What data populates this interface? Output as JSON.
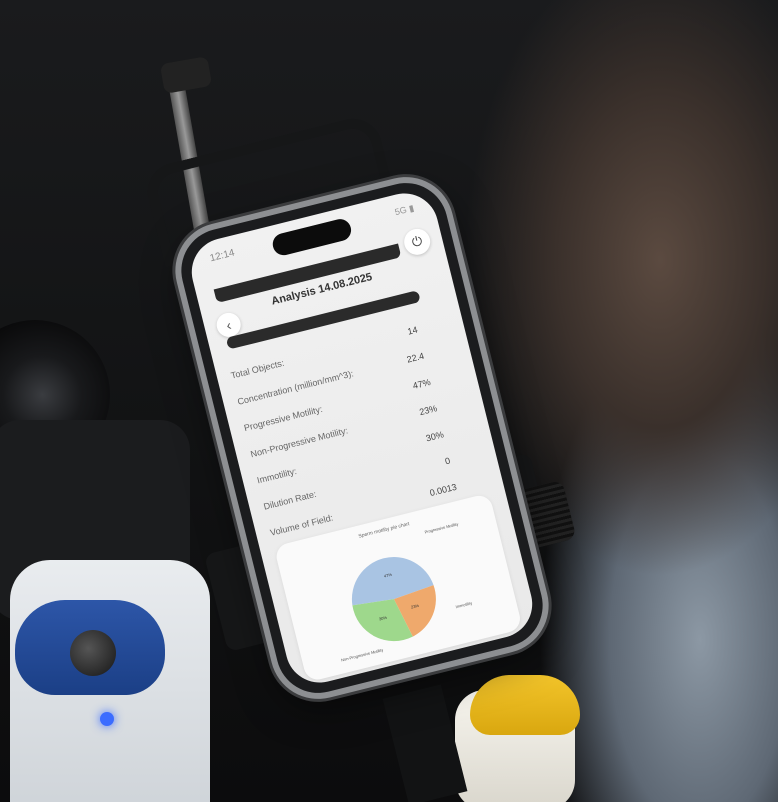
{
  "status": {
    "time": "12:14",
    "icons": "5G ▮"
  },
  "header": {
    "title": "Analysis 14.08.2025",
    "back_icon": "chevron-left-icon",
    "power_icon": "power-icon"
  },
  "metrics": [
    {
      "label": "Total Objects:",
      "value": "14"
    },
    {
      "label": "Concentration (million/mm^3):",
      "value": "22.4"
    },
    {
      "label": "Progressive Motility:",
      "value": "47%"
    },
    {
      "label": "Non-Progressive Motility:",
      "value": "23%"
    },
    {
      "label": "Immotility:",
      "value": "30%"
    },
    {
      "label": "Dilution Rate:",
      "value": "0"
    },
    {
      "label": "Volume of Field:",
      "value": "0.0013"
    }
  ],
  "chart_data": {
    "type": "pie",
    "title": "Sperm motility pie chart",
    "labels": [
      "Progressive Motility",
      "Non-Progressive Motility",
      "Immotility"
    ],
    "values": [
      47,
      23,
      30
    ],
    "slice_labels": [
      "47%",
      "23%",
      "30%"
    ],
    "colors": [
      "#a9c4e3",
      "#efa96c",
      "#9ed88c"
    ]
  }
}
